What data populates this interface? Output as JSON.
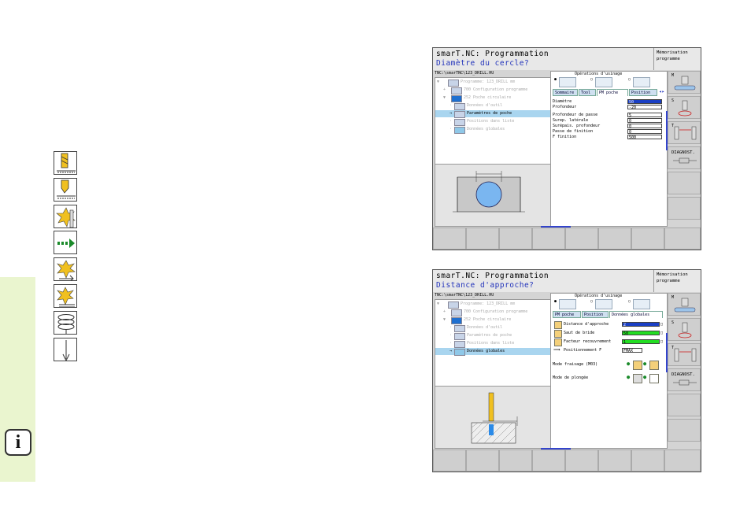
{
  "info_icon": "i",
  "tool_icons": [
    "drill-chip-icon",
    "drill-depth-icon",
    "spot-mill-icon",
    "arrow-feed-icon",
    "mill-side-icon",
    "mill-bottom-icon",
    "thread-spiral-icon",
    "drill-point-icon"
  ],
  "screen1": {
    "title": "smarT.NC: Programmation",
    "subtitle": "Diamètre du cercle?",
    "mode_line1": "Mémorisation",
    "mode_line2": "programme",
    "path": "TNC:\\smarTNC\\123_DRILL.HU",
    "tree": [
      {
        "exp": "▼",
        "label": "Programme: 123_DRILL mm",
        "state": "dim"
      },
      {
        "exp": "+",
        "label": "700 Configuration programme",
        "state": "dim"
      },
      {
        "exp": "▼",
        "label": "252 Poche circulaire",
        "state": "dim"
      },
      {
        "exp": "·",
        "label": "Données d'outil",
        "state": "dim"
      },
      {
        "exp": "→",
        "label": "Paramètres de poche",
        "state": "sel"
      },
      {
        "exp": "·",
        "label": "Positions dans liste",
        "state": "dim"
      },
      {
        "exp": "·",
        "label": "Données globales",
        "state": "dim"
      }
    ],
    "ops_title": "Opérations d'usinage",
    "tabs": [
      "Sommaire",
      "Tool",
      "PM poche",
      "Position"
    ],
    "active_tab": 2,
    "fields": [
      {
        "label": "Diamètre",
        "value": "50",
        "style": "sel"
      },
      {
        "label": "Profondeur",
        "value": "-20",
        "style": ""
      },
      {
        "label": "Profondeur de passe",
        "value": "5",
        "style": ""
      },
      {
        "label": "Surep. latérale",
        "value": "0",
        "style": ""
      },
      {
        "label": "Surépais. profondeur",
        "value": "0",
        "style": ""
      },
      {
        "label": "Passe de finition",
        "value": "0",
        "style": ""
      },
      {
        "label": "F finition",
        "value": "500",
        "style": ""
      }
    ]
  },
  "screen2": {
    "title": "smarT.NC: Programmation",
    "subtitle": "Distance d'approche?",
    "mode_line1": "Mémorisation",
    "mode_line2": "programme",
    "path": "TNC:\\smarTNC\\123_DRILL.HU",
    "tree": [
      {
        "exp": "▼",
        "label": "Programme: 123_DRILL mm",
        "state": "dim"
      },
      {
        "exp": "+",
        "label": "700 Configuration programme",
        "state": "dim"
      },
      {
        "exp": "▼",
        "label": "252 Poche circulaire",
        "state": "dim"
      },
      {
        "exp": "·",
        "label": "Données d'outil",
        "state": "dim"
      },
      {
        "exp": "·",
        "label": "Paramètres de poche",
        "state": "dim"
      },
      {
        "exp": "·",
        "label": "Positions dans liste",
        "state": "dim"
      },
      {
        "exp": "→",
        "label": "Données globales",
        "state": "sel"
      }
    ],
    "ops_title": "Opérations d'usinage",
    "tabs": [
      "PM poche",
      "Position",
      "Données globales"
    ],
    "active_tab": 2,
    "fields": [
      {
        "label": "Distance d'approche",
        "value": "2",
        "style": "blue"
      },
      {
        "label": "Saut de bride",
        "value": "50",
        "style": "green"
      },
      {
        "label": "Facteur recouvrement",
        "value": "1",
        "style": "green"
      },
      {
        "label": "Positionnement F",
        "value": "FMAX",
        "style": ""
      }
    ],
    "mode_fraisage": "Mode fraisage (M03)",
    "mode_plongee": "Mode de plongée"
  },
  "vkeys": [
    {
      "letter": "M"
    },
    {
      "letter": "S"
    },
    {
      "letter": "T"
    },
    {
      "letter": "",
      "title": "DIAGNOST."
    }
  ]
}
